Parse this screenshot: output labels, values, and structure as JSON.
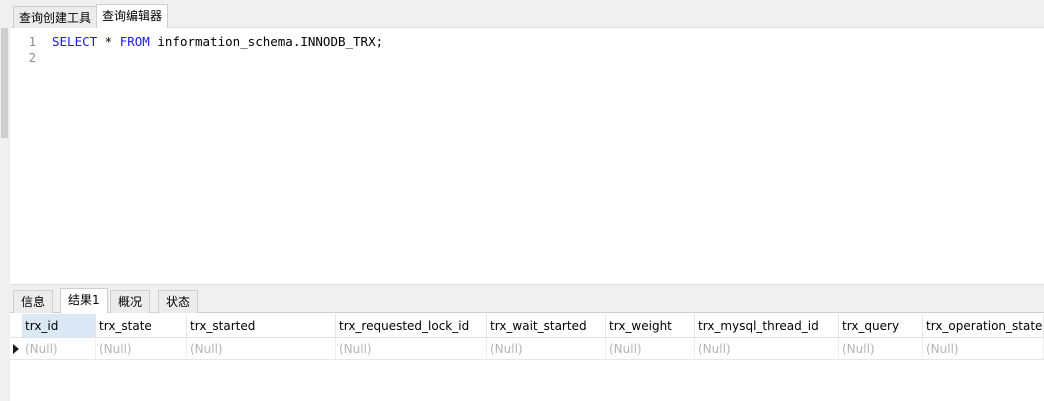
{
  "top_tabs": [
    {
      "label": "查询创建工具",
      "active": false
    },
    {
      "label": "查询编辑器",
      "active": true
    }
  ],
  "editor": {
    "lines": [
      {
        "number": "1",
        "tokens": [
          {
            "text": "SELECT",
            "kind": "kw"
          },
          {
            "text": " * ",
            "kind": "plain"
          },
          {
            "text": "FROM",
            "kind": "kw"
          },
          {
            "text": " information_schema.INNODB_TRX;",
            "kind": "plain"
          }
        ]
      },
      {
        "number": "2",
        "tokens": []
      }
    ]
  },
  "result_tabs": [
    {
      "label": "信息",
      "active": false
    },
    {
      "label": "结果1",
      "active": true
    },
    {
      "label": "概况",
      "active": false
    },
    {
      "label": "状态",
      "active": false
    }
  ],
  "grid": {
    "columns": [
      "trx_id",
      "trx_state",
      "trx_started",
      "trx_requested_lock_id",
      "trx_wait_started",
      "trx_weight",
      "trx_mysql_thread_id",
      "trx_query",
      "trx_operation_state"
    ],
    "rows": [
      [
        "(Null)",
        "(Null)",
        "(Null)",
        "(Null)",
        "(Null)",
        "(Null)",
        "(Null)",
        "(Null)",
        "(Null)"
      ]
    ]
  },
  "colors": {
    "keyword": "#1a1ae6",
    "null_text": "#b4b4b4",
    "selected_header": "#dbe9f7"
  }
}
